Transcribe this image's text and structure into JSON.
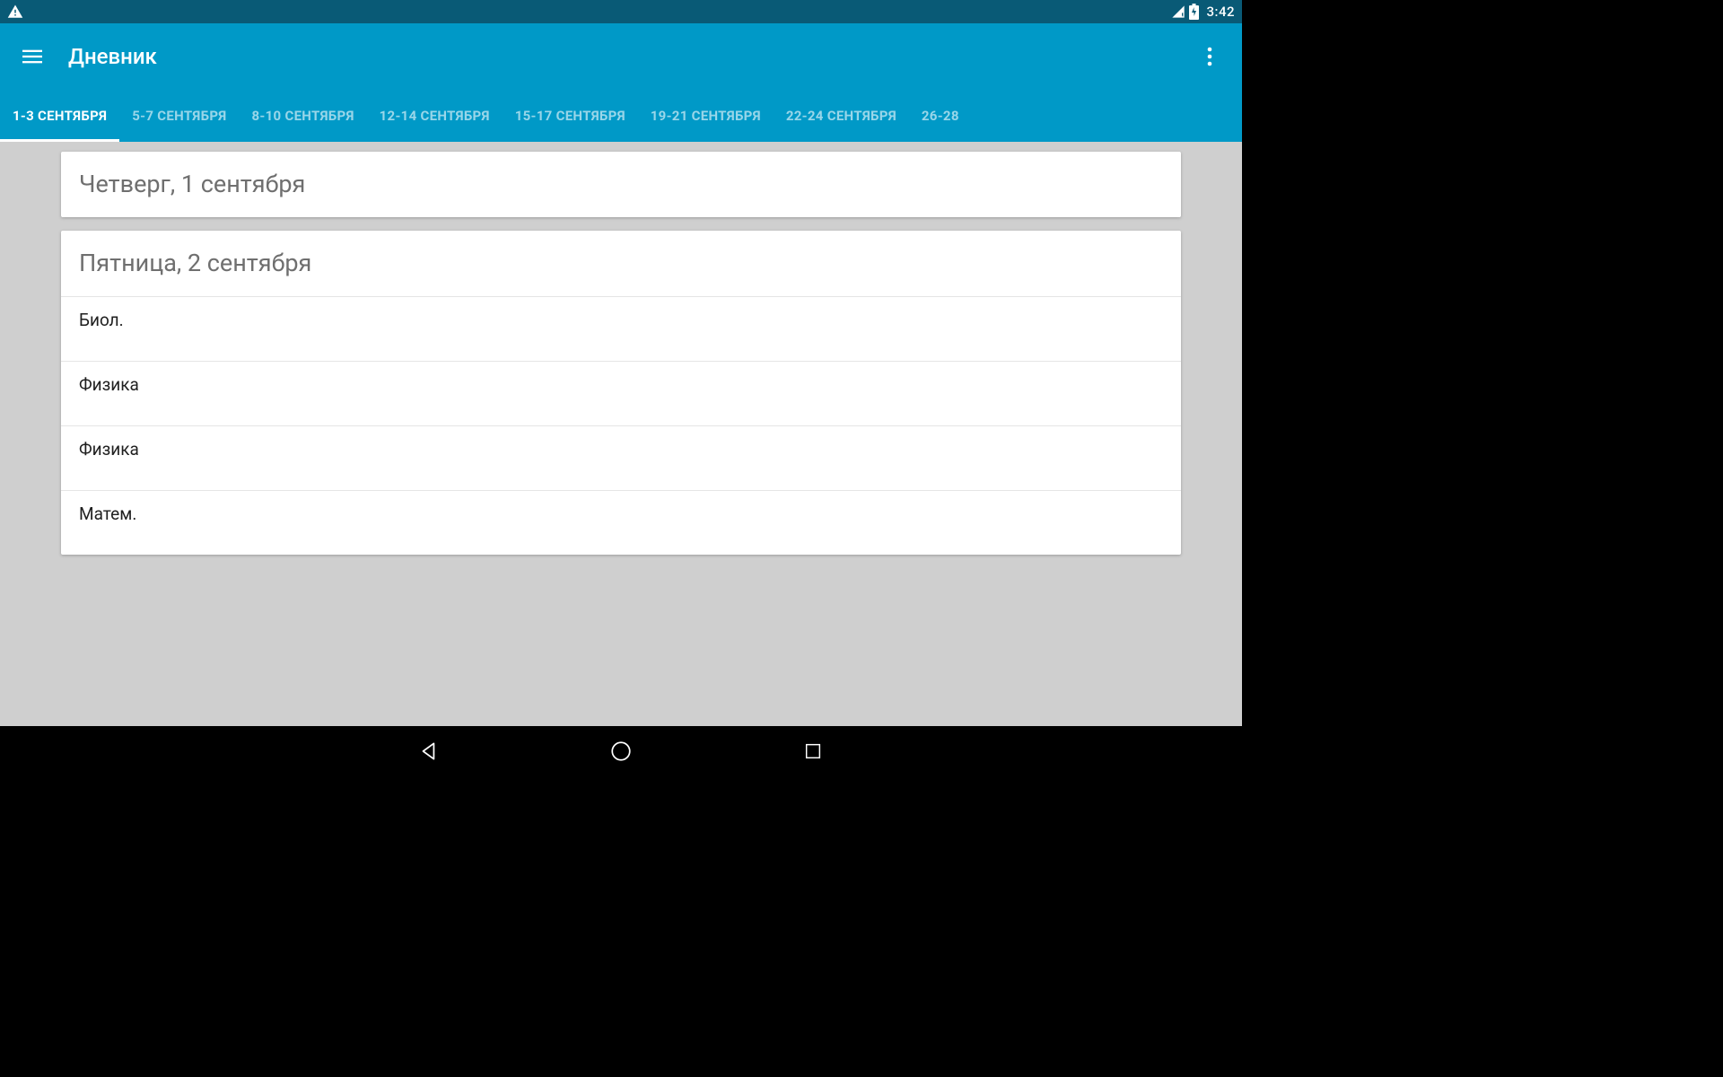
{
  "statusbar": {
    "time": "3:42"
  },
  "appbar": {
    "title": "Дневник"
  },
  "tabs": [
    {
      "label": "1-3 СЕНТЯБРЯ",
      "active": true
    },
    {
      "label": "5-7 СЕНТЯБРЯ",
      "active": false
    },
    {
      "label": "8-10 СЕНТЯБРЯ",
      "active": false
    },
    {
      "label": "12-14 СЕНТЯБРЯ",
      "active": false
    },
    {
      "label": "15-17 СЕНТЯБРЯ",
      "active": false
    },
    {
      "label": "19-21 СЕНТЯБРЯ",
      "active": false
    },
    {
      "label": "22-24 СЕНТЯБРЯ",
      "active": false
    },
    {
      "label": "26-28",
      "active": false
    }
  ],
  "days": [
    {
      "header": "Четверг, 1 сентября",
      "lessons": []
    },
    {
      "header": "Пятница, 2 сентября",
      "lessons": [
        "Биол.",
        "Физика",
        "Физика",
        "Матем."
      ]
    }
  ]
}
